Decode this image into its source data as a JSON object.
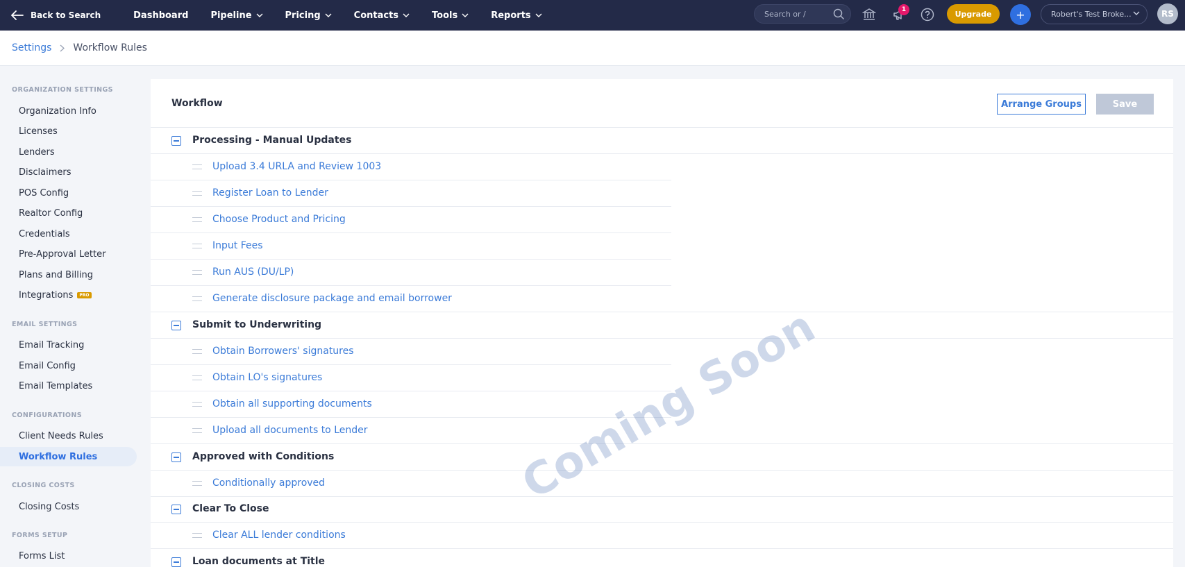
{
  "nav": {
    "back_label": "Back to Search",
    "items": [
      {
        "label": "Dashboard",
        "has_menu": false
      },
      {
        "label": "Pipeline",
        "has_menu": true
      },
      {
        "label": "Pricing",
        "has_menu": true
      },
      {
        "label": "Contacts",
        "has_menu": true
      },
      {
        "label": "Tools",
        "has_menu": true
      },
      {
        "label": "Reports",
        "has_menu": true
      }
    ],
    "search_placeholder": "Search or /",
    "notification_count": "1",
    "upgrade_label": "Upgrade",
    "add_label": "+",
    "account_label": "Robert's Test Broke...",
    "avatar_initials": "RS",
    "colors": {
      "bar": "#232a48",
      "upgrade": "#d99a00",
      "accent": "#2f6fe0",
      "badge": "#e5186b"
    }
  },
  "breadcrumb": {
    "root": "Settings",
    "current": "Workflow Rules"
  },
  "sidebar": {
    "sections": [
      {
        "title": "ORGANIZATION SETTINGS",
        "items": [
          "Organization Info",
          "Licenses",
          "Lenders",
          "Disclaimers",
          "POS Config",
          "Realtor Config",
          "Credentials",
          "Pre-Approval Letter",
          "Plans and Billing",
          "Integrations"
        ]
      },
      {
        "title": "EMAIL SETTINGS",
        "items": [
          "Email Tracking",
          "Email Config",
          "Email Templates"
        ]
      },
      {
        "title": "CONFIGURATIONS",
        "items": [
          "Client Needs Rules",
          "Workflow Rules"
        ]
      },
      {
        "title": "CLOSING COSTS",
        "items": [
          "Closing Costs"
        ]
      },
      {
        "title": "FORMS SETUP",
        "items": [
          "Forms List"
        ]
      }
    ],
    "pro_badge": "PRO",
    "active_item": "Workflow Rules"
  },
  "workflow": {
    "title": "Workflow",
    "arrange_label": "Arrange Groups",
    "save_label": "Save",
    "groups": [
      {
        "name": "Processing - Manual Updates",
        "tasks": [
          "Upload 3.4 URLA and Review 1003",
          "Register Loan to Lender",
          "Choose Product and Pricing",
          "Input Fees",
          "Run AUS (DU/LP)",
          "Generate disclosure package and email borrower"
        ]
      },
      {
        "name": "Submit to Underwriting",
        "tasks": [
          "Obtain Borrowers' signatures",
          "Obtain LO's signatures",
          "Obtain all supporting documents",
          "Upload all documents to Lender"
        ]
      },
      {
        "name": "Approved with Conditions",
        "tasks": [
          "Conditionally approved"
        ]
      },
      {
        "name": "Clear To Close",
        "tasks": [
          "Clear ALL lender conditions"
        ]
      },
      {
        "name": "Loan documents at Title",
        "tasks": []
      }
    ],
    "watermark": "Coming Soon"
  }
}
